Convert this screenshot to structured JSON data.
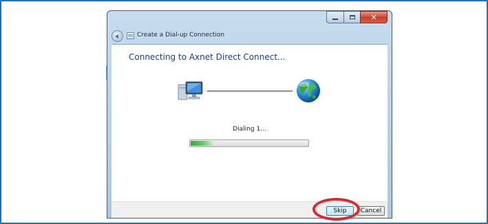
{
  "window": {
    "title": "Create a Dial-up Connection",
    "controls": {
      "minimize_icon": "minimize-icon",
      "maximize_icon": "maximize-icon",
      "close_icon": "close-icon"
    },
    "back_icon": "back-arrow-icon",
    "title_icon": "dialup-connection-icon"
  },
  "content": {
    "heading": "Connecting to Axnet Direct Connect...",
    "computer_icon": "computer-icon",
    "network_icon": "globe-icon",
    "status": "Dialing 1...",
    "progress": 0.2
  },
  "footer": {
    "skip_label": "Skip",
    "cancel_label": "Cancel"
  },
  "annotation": {
    "highlight_target": "skip-button",
    "color": "#e1262c"
  },
  "colors": {
    "frame_border": "#1b75bb",
    "heading_text": "#1a3d8f",
    "progress_green": "#26b02d"
  }
}
